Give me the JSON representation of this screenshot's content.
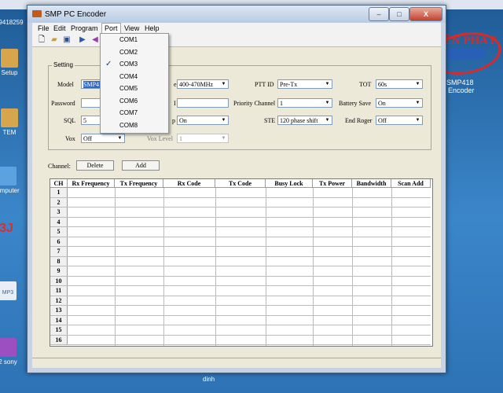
{
  "window": {
    "title": "SMP PC Encoder",
    "controls": [
      "–",
      "□",
      "X"
    ]
  },
  "menu": [
    "File",
    "Edit",
    "Program",
    "Port",
    "View",
    "Help"
  ],
  "port_menu": {
    "items": [
      "COM1",
      "COM2",
      "COM3",
      "COM4",
      "COM5",
      "COM6",
      "COM7",
      "COM8"
    ],
    "checked_index": 2
  },
  "setting": {
    "group_label": "Setting",
    "model_label": "Model",
    "model_value": "SMP41",
    "freq_label": "e",
    "freq_value": "400-470MHz",
    "ptt_label": "PTT ID",
    "ptt_value": "Pre-Tx",
    "tot_label": "TOT",
    "tot_value": "60s",
    "password_label": "Password",
    "password_value": "",
    "ani_label": "I",
    "ani_value": "",
    "priority_label": "Priority Channel",
    "priority_value": "1",
    "battery_label": "Battery Save",
    "battery_value": "On",
    "sql_label": "SQL",
    "sql_value": "5",
    "beep_label": "p",
    "beep_value": "On",
    "ste_label": "STE",
    "ste_value": "120  phase shift",
    "endroger_label": "End Roger",
    "endroger_value": "Off",
    "vox_label": "Vox",
    "vox_value": "Off",
    "voxlevel_label": "Vox Level",
    "voxlevel_value": "1"
  },
  "channel": {
    "label": "Channel:",
    "delete": "Delete",
    "add": "Add"
  },
  "table": {
    "headers": [
      "CH",
      "Rx Frequency",
      "Tx Frequency",
      "Rx Code",
      "Tx Code",
      "Busy Lock",
      "Tx Power",
      "Bandwidth",
      "Scan Add"
    ],
    "rows": [
      "1",
      "2",
      "3",
      "4",
      "5",
      "6",
      "7",
      "8",
      "9",
      "10",
      "11",
      "12",
      "13",
      "14",
      "15",
      "16"
    ]
  },
  "desktop": {
    "left_labels": [
      "9418259",
      "Setup",
      "TEM",
      "omputer",
      "3J",
      "",
      "MP3",
      "2 sony"
    ],
    "right_labels": [
      "SMP418",
      "Encoder"
    ],
    "logo_text": "YÊN PHÁT",
    "taskbar_text": "dinh"
  }
}
